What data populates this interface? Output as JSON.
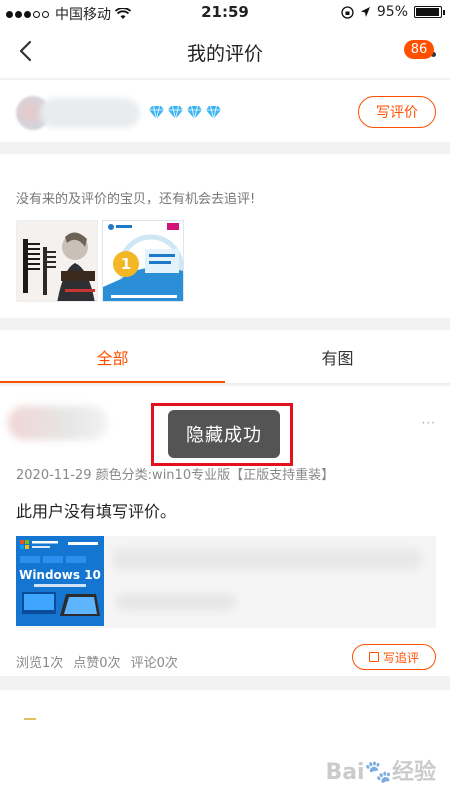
{
  "status_bar": {
    "carrier": "中国移动",
    "time": "21:59",
    "battery": "95%",
    "battery_level": 0.95
  },
  "nav": {
    "title": "我的评价",
    "badge": "86"
  },
  "user": {
    "diamond_count": 4,
    "write_review_label": "写评价"
  },
  "pending": {
    "hint": "没有来的及评价的宝贝，还有机会去追评!",
    "recharge_card_badge": "1"
  },
  "tabs": [
    {
      "label": "全部"
    },
    {
      "label": "有图"
    }
  ],
  "review": {
    "meta": "2020-11-29 颜色分类:win10专业版【正版支持重装】",
    "text": "此用户没有填写评价。",
    "product_thumb_title": "Windows 10",
    "stats": [
      "浏览1次",
      "点赞0次",
      "评论0次"
    ],
    "follow_up_label": "写追评"
  },
  "toast": {
    "text": "隐藏成功"
  },
  "colors": {
    "accent": "#ff5000",
    "highlight": "#e3111c",
    "diamond": "#3ab4f2"
  }
}
